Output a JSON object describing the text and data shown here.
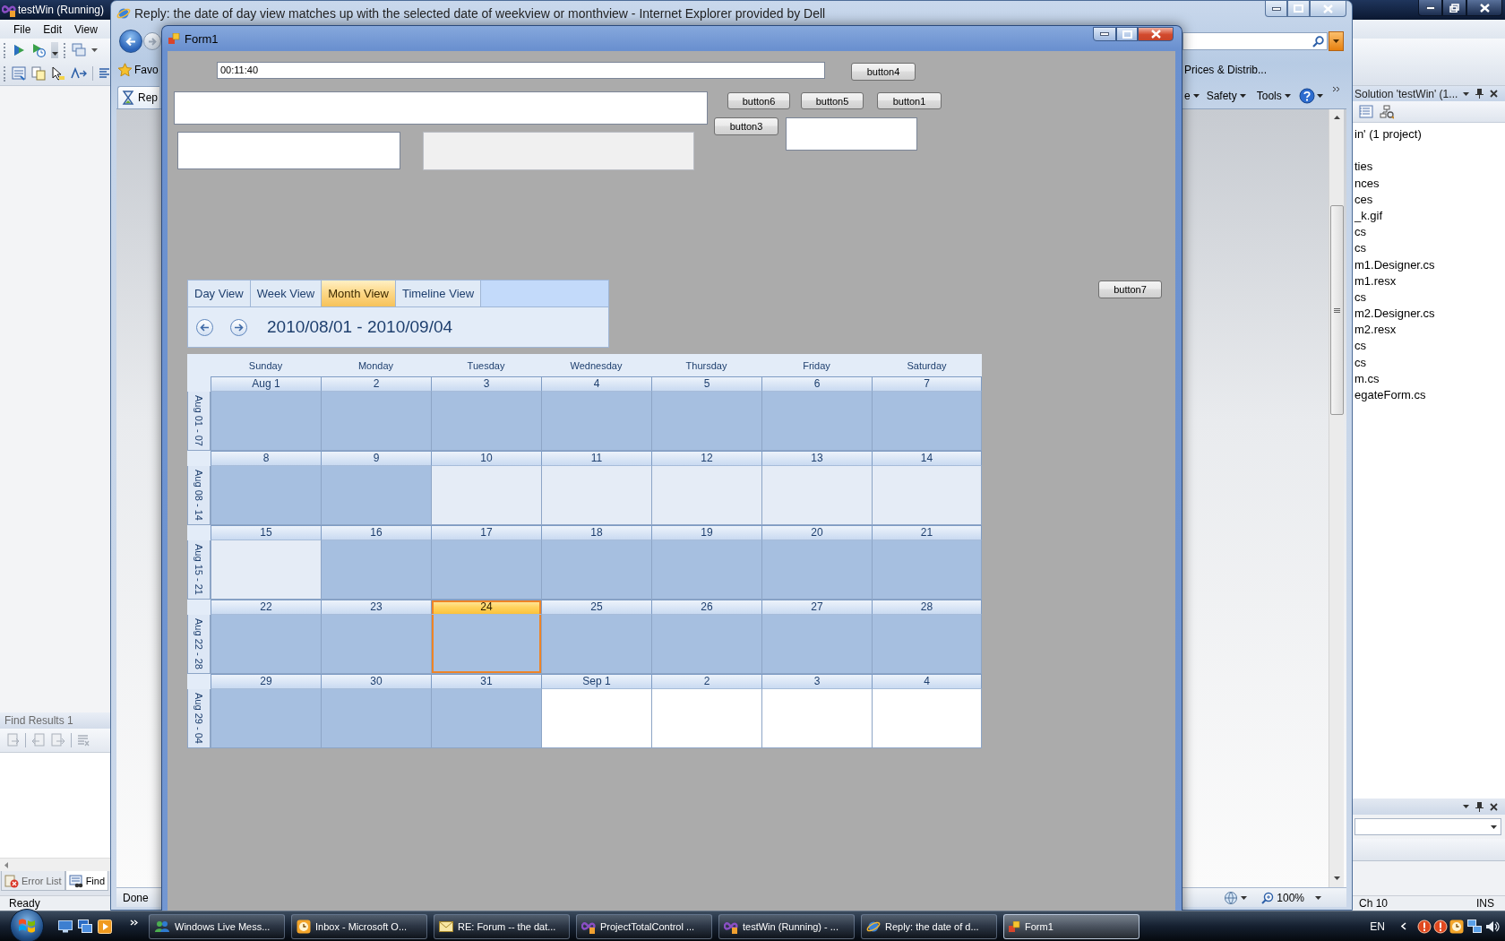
{
  "vs_window": {
    "title": "testWin (Running)",
    "menu": [
      "File",
      "Edit",
      "View"
    ],
    "find_results": {
      "title": "Find Results 1",
      "tabs": [
        {
          "label": "Error List",
          "selected": false
        },
        {
          "label": "Find",
          "selected": true
        }
      ]
    },
    "solution_explorer": {
      "title": "Solution 'testWin' (1...",
      "items": [
        "in' (1 project)",
        "ties",
        "nces",
        "ces",
        "_k.gif",
        "cs",
        "cs",
        "m1.Designer.cs",
        "m1.resx",
        "cs",
        "m2.Designer.cs",
        "m2.resx",
        "cs",
        "cs",
        "m.cs",
        "egateForm.cs"
      ]
    },
    "status_bar": {
      "message": "Ready",
      "column": "Ch 10",
      "mode": "INS"
    }
  },
  "ie_window": {
    "title": "Reply: the date of day view matches up with the selected date of weekview or monthview - Internet Explorer provided by Dell",
    "favorites": {
      "label": "Favo",
      "link": "Prices & Distrib..."
    },
    "tab": {
      "label": "Rep"
    },
    "commands": [
      "e",
      "Safety",
      "Tools"
    ],
    "status": "Done",
    "zoom": "100%"
  },
  "form_window": {
    "title": "Form1",
    "time_field": {
      "value": "00:11:40"
    },
    "top_button": {
      "label": "button4"
    },
    "button_row": [
      {
        "label": "button6"
      },
      {
        "label": "button5"
      },
      {
        "label": "button1"
      }
    ],
    "side_button": {
      "label": "button3"
    },
    "calendar_button": {
      "label": "button7"
    },
    "text_boxes": [
      {
        "disabled": false
      },
      {
        "disabled": false
      },
      {
        "disabled": true
      },
      {
        "disabled": false
      }
    ],
    "calendar": {
      "tabs": [
        {
          "label": "Day View",
          "selected": false
        },
        {
          "label": "Week View",
          "selected": false
        },
        {
          "label": "Month View",
          "selected": true
        },
        {
          "label": "Timeline View",
          "selected": false
        }
      ],
      "range": "2010/08/01 - 2010/09/04",
      "weekdays": [
        "Sunday",
        "Monday",
        "Tuesday",
        "Wednesday",
        "Thursday",
        "Friday",
        "Saturday"
      ],
      "weeks": [
        {
          "label": "Aug 01 - 07",
          "days": [
            {
              "date": "Aug 1",
              "selected": true,
              "today": false,
              "other_month": false
            },
            {
              "date": "2",
              "selected": true,
              "today": false,
              "other_month": false
            },
            {
              "date": "3",
              "selected": true,
              "today": false,
              "other_month": false
            },
            {
              "date": "4",
              "selected": true,
              "today": false,
              "other_month": false
            },
            {
              "date": "5",
              "selected": true,
              "today": false,
              "other_month": false
            },
            {
              "date": "6",
              "selected": true,
              "today": false,
              "other_month": false
            },
            {
              "date": "7",
              "selected": true,
              "today": false,
              "other_month": false
            }
          ]
        },
        {
          "label": "Aug 08 - 14",
          "days": [
            {
              "date": "8",
              "selected": true,
              "today": false,
              "other_month": false
            },
            {
              "date": "9",
              "selected": true,
              "today": false,
              "other_month": false
            },
            {
              "date": "10",
              "selected": false,
              "today": false,
              "other_month": false
            },
            {
              "date": "11",
              "selected": false,
              "today": false,
              "other_month": false
            },
            {
              "date": "12",
              "selected": false,
              "today": false,
              "other_month": false
            },
            {
              "date": "13",
              "selected": false,
              "today": false,
              "other_month": false
            },
            {
              "date": "14",
              "selected": false,
              "today": false,
              "other_month": false
            }
          ]
        },
        {
          "label": "Aug 15 - 21",
          "days": [
            {
              "date": "15",
              "selected": false,
              "today": false,
              "other_month": false
            },
            {
              "date": "16",
              "selected": true,
              "today": false,
              "other_month": false
            },
            {
              "date": "17",
              "selected": true,
              "today": false,
              "other_month": false
            },
            {
              "date": "18",
              "selected": true,
              "today": false,
              "other_month": false
            },
            {
              "date": "19",
              "selected": true,
              "today": false,
              "other_month": false
            },
            {
              "date": "20",
              "selected": true,
              "today": false,
              "other_month": false
            },
            {
              "date": "21",
              "selected": true,
              "today": false,
              "other_month": false
            }
          ]
        },
        {
          "label": "Aug 22 - 28",
          "days": [
            {
              "date": "22",
              "selected": true,
              "today": false,
              "other_month": false
            },
            {
              "date": "23",
              "selected": true,
              "today": false,
              "other_month": false
            },
            {
              "date": "24",
              "selected": true,
              "today": true,
              "other_month": false
            },
            {
              "date": "25",
              "selected": true,
              "today": false,
              "other_month": false
            },
            {
              "date": "26",
              "selected": true,
              "today": false,
              "other_month": false
            },
            {
              "date": "27",
              "selected": true,
              "today": false,
              "other_month": false
            },
            {
              "date": "28",
              "selected": true,
              "today": false,
              "other_month": false
            }
          ]
        },
        {
          "label": "Aug 29 - 04",
          "days": [
            {
              "date": "29",
              "selected": true,
              "today": false,
              "other_month": false
            },
            {
              "date": "30",
              "selected": true,
              "today": false,
              "other_month": false
            },
            {
              "date": "31",
              "selected": true,
              "today": false,
              "other_month": false
            },
            {
              "date": "Sep 1",
              "selected": false,
              "today": false,
              "other_month": true
            },
            {
              "date": "2",
              "selected": false,
              "today": false,
              "other_month": true
            },
            {
              "date": "3",
              "selected": false,
              "today": false,
              "other_month": true
            },
            {
              "date": "4",
              "selected": false,
              "today": false,
              "other_month": true
            }
          ]
        }
      ]
    }
  },
  "taskbar": {
    "items": [
      {
        "label": "Windows Live Mess...",
        "kind": "people",
        "selected": false
      },
      {
        "label": "Inbox - Microsoft O...",
        "kind": "clock",
        "selected": false
      },
      {
        "label": "RE: Forum -- the dat...",
        "kind": "envelope",
        "selected": false
      },
      {
        "label": "ProjectTotalControl ...",
        "kind": "loop",
        "selected": false
      },
      {
        "label": "testWin (Running) - ...",
        "kind": "loop",
        "selected": false
      },
      {
        "label": "Reply: the date of d...",
        "kind": "planet",
        "selected": false
      },
      {
        "label": "Form1",
        "kind": "squares",
        "selected": true
      }
    ],
    "language": "EN"
  }
}
